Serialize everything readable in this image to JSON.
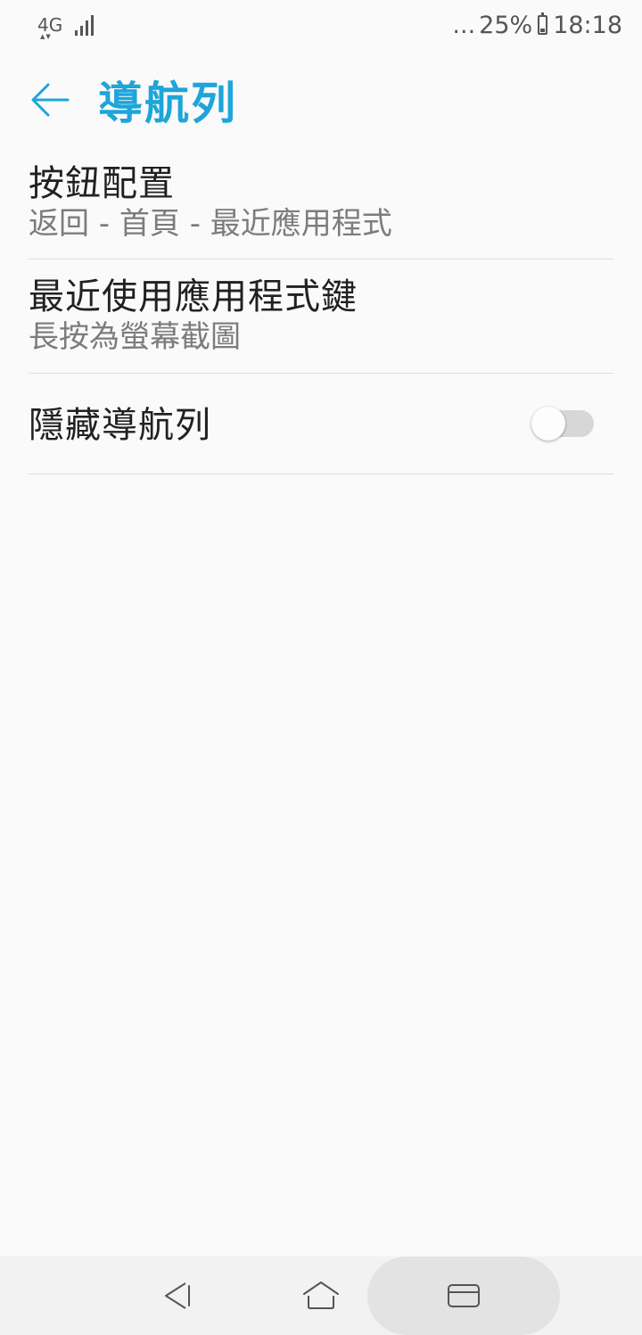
{
  "status_bar": {
    "network": "4G",
    "network_arrows": "▲▼",
    "signal_bars": 4,
    "notification_more": "...",
    "battery_percent": "25%",
    "battery_level": 0.25,
    "time": "18:18"
  },
  "app_bar": {
    "back_icon": "arrow-left-icon",
    "title": "導航列",
    "accent_color": "#1ea5d9"
  },
  "settings": {
    "button_layout": {
      "title": "按鈕配置",
      "summary": "返回 - 首頁 - 最近應用程式"
    },
    "recent_apps_key": {
      "title": "最近使用應用程式鍵",
      "summary": "長按為螢幕截圖"
    },
    "hide_nav_bar": {
      "title": "隱藏導航列",
      "toggle_on": false
    }
  },
  "nav_bar": {
    "back_icon": "triangle-back-icon",
    "home_icon": "home-icon",
    "recent_icon": "recent-apps-icon"
  }
}
